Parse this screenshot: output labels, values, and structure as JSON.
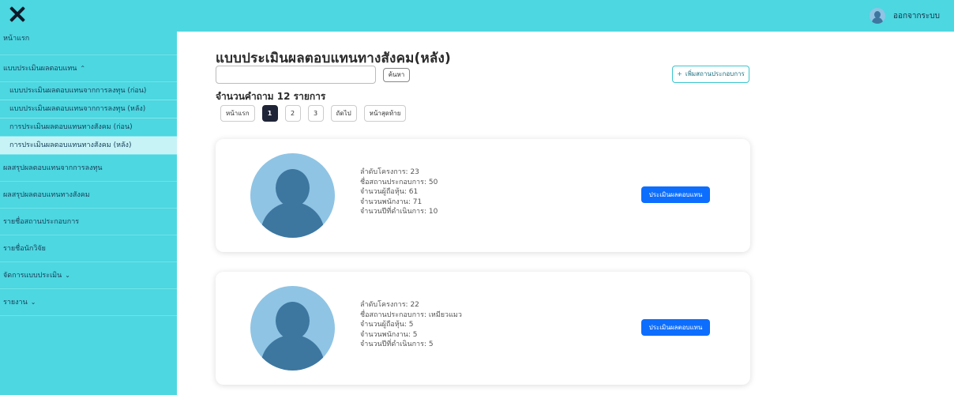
{
  "header": {
    "logout_label": "ออกจากระบบ"
  },
  "sidebar": {
    "home": "หน้าแรก",
    "evaluation_group": "แบบประเมินผลตอบแทน",
    "sub_items": [
      "แบบประเมินผลตอบแทนจากการลงทุน (ก่อน)",
      "แบบประเมินผลตอบแทนจากการลงทุน (หลัง)",
      "การประเมินผลตอบแทนทางสังคม (ก่อน)",
      "การประเมินผลตอบแทนทางสังคม (หลัง)"
    ],
    "main_items": [
      "ผลสรุปผลตอบแทนจากการลงทุน",
      "ผลสรุปผลตอบแทนทางสังคม",
      "รายชื่อสถานประกอบการ",
      "รายชื่อนักวิจัย"
    ],
    "manage_group": "จัดการแบบประเมิน",
    "report_group": "รายงาน",
    "caret_up": "⌃",
    "caret_down": "⌄"
  },
  "main": {
    "title": "แบบประเมินผลตอบแทนทางสังคม(หลัง)",
    "search_value": "",
    "search_button": "ค้นหา",
    "add_button": "เพิ่มสถานประกอบการ",
    "add_plus": "+",
    "count_text": "จำนวนคำถาม 12 รายการ",
    "pagination": {
      "first": "หน้าแรก",
      "pages": [
        "1",
        "2",
        "3"
      ],
      "next": "ถัดไป",
      "last": "หน้าสุดท้าย"
    },
    "cards": [
      {
        "lines": [
          "ลำดับโครงการ: 23",
          "ชื่อสถานประกอบการ: 50",
          "จำนวนผู้ถือหุ้น: 61",
          "จำนวนพนักงาน: 71",
          "จำนวนปีที่ดำเนินการ: 10"
        ],
        "button": "ประเมินผลตอบแทน"
      },
      {
        "lines": [
          "ลำดับโครงการ: 22",
          "ชื่อสถานประกอบการ: เหมียวแมว",
          "จำนวนผู้ถือหุ้น: 5",
          "จำนวนพนักงาน: 5",
          "จำนวนปีที่ดำเนินการ: 5"
        ],
        "button": "ประเมินผลตอบแทน"
      }
    ]
  },
  "colors": {
    "teal": "#4dd7e0",
    "active_sub": "#c7f3f7",
    "primary_button": "#0d6efd",
    "active_page": "#1f2437"
  }
}
